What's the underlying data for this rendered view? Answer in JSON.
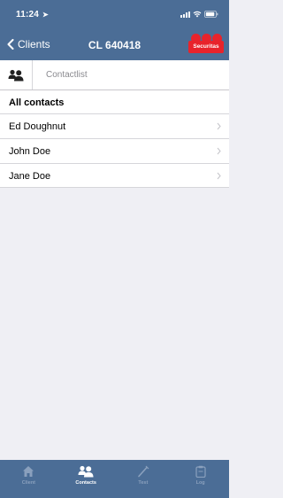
{
  "status_bar": {
    "time": "11:24",
    "location_arrow": "location-arrow-icon",
    "icons": [
      "signal-icon",
      "wifi-icon",
      "battery-icon"
    ]
  },
  "nav": {
    "back_label": "Clients",
    "title": "CL 640418",
    "logo_text": "Securitas"
  },
  "subheader": {
    "icon": "contacts-group-icon",
    "label": "Contactlist"
  },
  "section": {
    "title": "All contacts"
  },
  "contacts": [
    {
      "name": "Ed Doughnut"
    },
    {
      "name": "John Doe"
    },
    {
      "name": "Jane Doe"
    }
  ],
  "tabs": [
    {
      "label": "Client",
      "icon": "house-icon",
      "active": false
    },
    {
      "label": "Contacts",
      "icon": "contacts-icon",
      "active": true
    },
    {
      "label": "Test",
      "icon": "wand-icon",
      "active": false
    },
    {
      "label": "Log",
      "icon": "clipboard-icon",
      "active": false
    }
  ],
  "colors": {
    "header_bg": "#4b6d96",
    "logo_red": "#e8232b",
    "page_bg": "#efeff4"
  }
}
